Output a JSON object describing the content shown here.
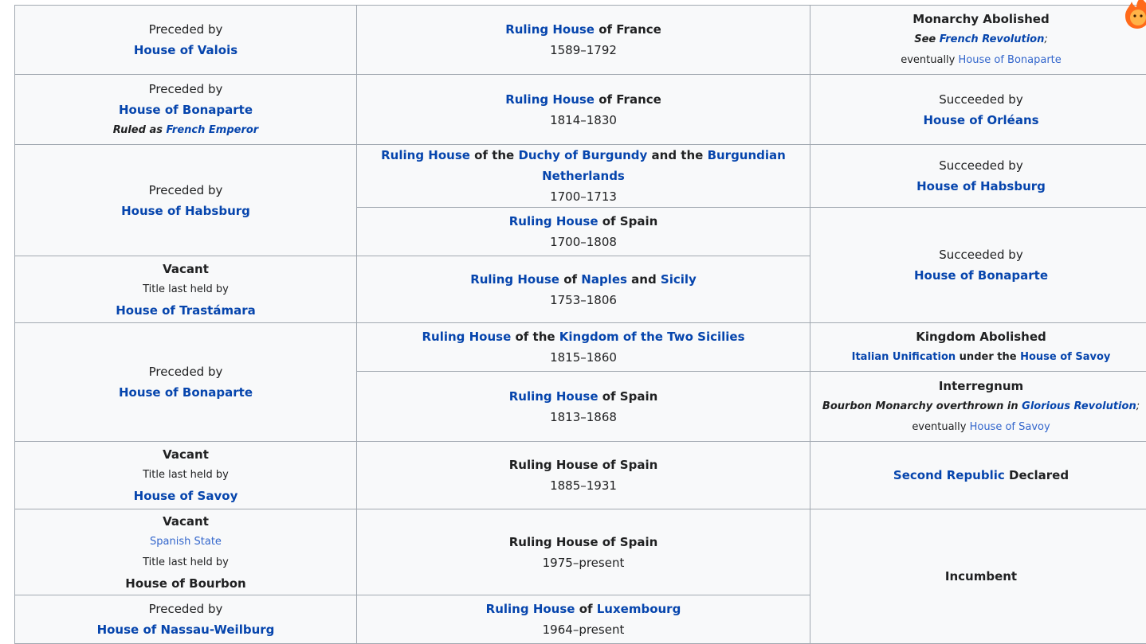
{
  "rows": {
    "r1": {
      "left": {
        "pre": "Preceded by",
        "link": "House of Valois"
      },
      "mid": {
        "link": "Ruling House",
        "suffix": " of France",
        "years": "1589–1792"
      },
      "right": {
        "title": "Monarchy Abolished",
        "see": "See ",
        "see_link": "French Revolution",
        "semi": ";",
        "eventually": "eventually ",
        "ev_link": "House of Bonaparte"
      }
    },
    "r2": {
      "left": {
        "pre": "Preceded by",
        "link": "House of Bonaparte",
        "note_ital": "Ruled as ",
        "note_link": "French Emperor"
      },
      "mid": {
        "link": "Ruling House",
        "suffix": " of France",
        "years": "1814–1830"
      },
      "right": {
        "pre": "Succeeded by",
        "link": "House of Orléans"
      }
    },
    "r3": {
      "left": {
        "pre": "Preceded by",
        "link": "House of Habsburg"
      },
      "mid": {
        "link": "Ruling House",
        "t1": " of the ",
        "link2": "Duchy of Burgundy",
        "t2": " and the ",
        "link3": "Burgundian Netherlands",
        "years": "1700–1713"
      },
      "right": {
        "pre": "Succeeded by",
        "link": "House of Habsburg"
      }
    },
    "r4": {
      "mid": {
        "link": "Ruling House",
        "suffix": " of Spain",
        "years": "1700–1808"
      },
      "right": {
        "pre": "Succeeded by",
        "link": "House of Bonaparte"
      }
    },
    "r5": {
      "left": {
        "title": "Vacant",
        "sub": "Title last held by",
        "link": "House of Trastámara"
      },
      "mid": {
        "link": "Ruling House",
        "t1": " of ",
        "link2": "Naples",
        "t2": " and ",
        "link3": "Sicily",
        "years": "1753–1806"
      }
    },
    "r6": {
      "left": {
        "pre": "Preceded by",
        "link": "House of Bonaparte"
      },
      "mid": {
        "link": "Ruling House",
        "t1": " of the ",
        "link2": "Kingdom of the Two Sicilies",
        "years": "1815–1860"
      },
      "right": {
        "title": "Kingdom Abolished",
        "link": "Italian Unification",
        "t1": " under the ",
        "link2": "House of Savoy"
      }
    },
    "r7": {
      "mid": {
        "link": "Ruling House",
        "suffix": " of Spain",
        "years": "1813–1868"
      },
      "right": {
        "title": "Interregnum",
        "ital": "Bourbon Monarchy overthrown in ",
        "ital_link": "Glorious Revolution",
        "semi": ";",
        "eventually": "eventually ",
        "ev_link": "House of Savoy"
      }
    },
    "r8": {
      "left": {
        "title": "Vacant",
        "sub": "Title last held by",
        "link": "House of Savoy"
      },
      "mid": {
        "label": "Ruling House of Spain",
        "years": "1885–1931"
      },
      "right": {
        "link": "Second Republic",
        "suffix": " Declared"
      }
    },
    "r9": {
      "left": {
        "title": "Vacant",
        "state_link": "Spanish State",
        "sub": "Title last held by",
        "house": "House of Bourbon"
      },
      "mid": {
        "label": "Ruling House of Spain",
        "years": "1975–present"
      },
      "right": {
        "label": "Incumbent"
      }
    },
    "r10": {
      "left": {
        "pre": "Preceded by",
        "link": "House of Nassau-Weilburg"
      },
      "mid": {
        "link": "Ruling House",
        "t1": " of ",
        "link2": "Luxembourg",
        "years": "1964–present"
      }
    }
  }
}
